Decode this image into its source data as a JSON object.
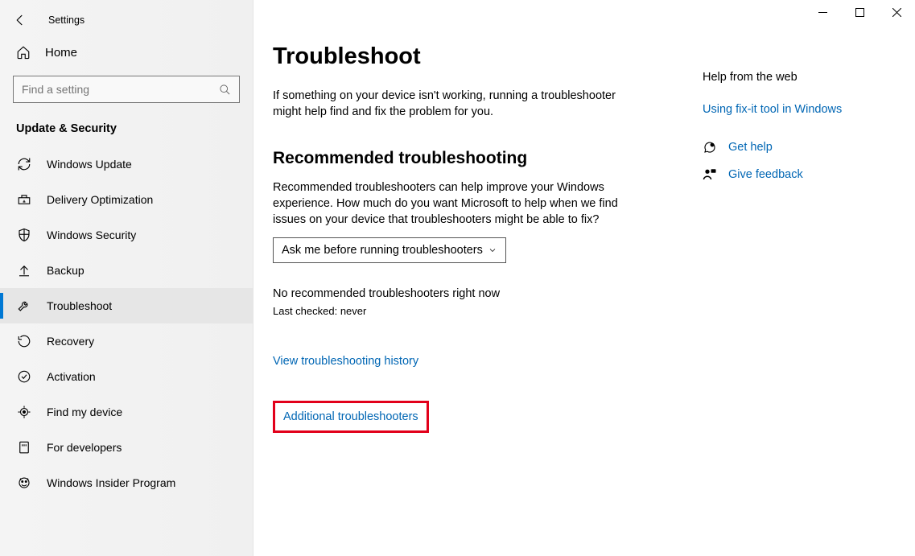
{
  "window": {
    "title": "Settings"
  },
  "sidebar": {
    "home_label": "Home",
    "search_placeholder": "Find a setting",
    "category_title": "Update & Security",
    "items": [
      {
        "label": "Windows Update"
      },
      {
        "label": "Delivery Optimization"
      },
      {
        "label": "Windows Security"
      },
      {
        "label": "Backup"
      },
      {
        "label": "Troubleshoot"
      },
      {
        "label": "Recovery"
      },
      {
        "label": "Activation"
      },
      {
        "label": "Find my device"
      },
      {
        "label": "For developers"
      },
      {
        "label": "Windows Insider Program"
      }
    ]
  },
  "main": {
    "title": "Troubleshoot",
    "intro": "If something on your device isn't working, running a troubleshooter might help find and fix the problem for you.",
    "section_title": "Recommended troubleshooting",
    "section_body": "Recommended troubleshooters can help improve your Windows experience. How much do you want Microsoft to help when we find issues on your device that troubleshooters might be able to fix?",
    "dropdown_value": "Ask me before running troubleshooters",
    "status_line": "No recommended troubleshooters right now",
    "last_checked": "Last checked: never",
    "history_link": "View troubleshooting history",
    "additional_link": "Additional troubleshooters"
  },
  "aside": {
    "heading": "Help from the web",
    "web_link": "Using fix-it tool in Windows",
    "get_help": "Get help",
    "give_feedback": "Give feedback"
  }
}
